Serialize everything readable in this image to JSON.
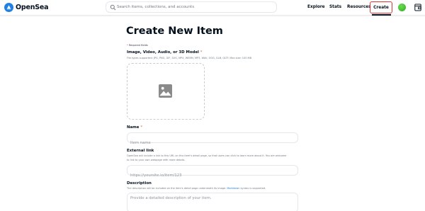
{
  "header": {
    "brand": "OpenSea",
    "search_placeholder": "Search items, collections, and accounts",
    "nav": {
      "explore": "Explore",
      "stats": "Stats",
      "resources": "Resources",
      "create": "Create"
    },
    "icons": [
      "opensea-logo-icon",
      "search-icon",
      "avatar",
      "wallet-icon"
    ]
  },
  "page": {
    "title": "Create New Item",
    "required_note_star": "*",
    "required_note": "Required fields",
    "media": {
      "label": "Image, Video, Audio, or 3D Model",
      "star": "*",
      "hint": "File types supported: JPG, PNG, GIF, SVG, MP4, WEBM, MP3, WAV, OGG, GLB, GLTF. Max size: 100 MB"
    },
    "name": {
      "label": "Name",
      "star": "*",
      "placeholder": "Item name"
    },
    "external_link": {
      "label": "External link",
      "hint_line1": "OpenSea will include a link to this URL on this item's detail page, so that users can click to learn more about it. You are welcome",
      "hint_line2": "to link to your own webpage with more details.",
      "placeholder": "https://yoursite.io/item/123"
    },
    "description": {
      "label": "Description",
      "hint_before": "The description will be included on the item's detail page underneath its image.",
      "hint_link": "Markdown",
      "hint_after": "syntax is supported.",
      "placeholder": "Provide a detailed description of your item."
    }
  },
  "colors": {
    "brand_blue": "#2081e2",
    "required_star": "#eb5757",
    "create_highlight": "#e03333",
    "avatar_green": "#2eaa2c"
  }
}
